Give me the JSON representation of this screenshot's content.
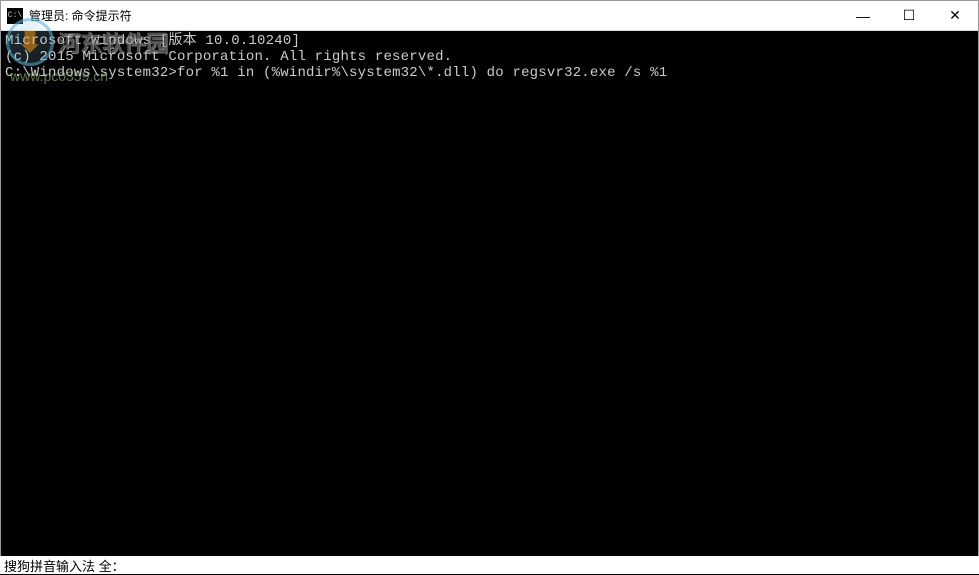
{
  "titlebar": {
    "icon_text": "C:\\",
    "title": "管理员: 命令提示符"
  },
  "terminal": {
    "line1": "Microsoft Windows [版本 10.0.10240]",
    "line2": "(c) 2015 Microsoft Corporation. All rights reserved.",
    "line3": "",
    "prompt": "C:\\Windows\\system32>",
    "command": "for %1 in (%windir%\\system32\\*.dll) do regsvr32.exe /s %1"
  },
  "ime": {
    "status": "搜狗拼音输入法 全："
  },
  "watermark": {
    "text": "河东软件园",
    "url": "www.pc0359.cn"
  },
  "buttons": {
    "minimize": "—",
    "maximize": "☐",
    "close": "✕"
  }
}
